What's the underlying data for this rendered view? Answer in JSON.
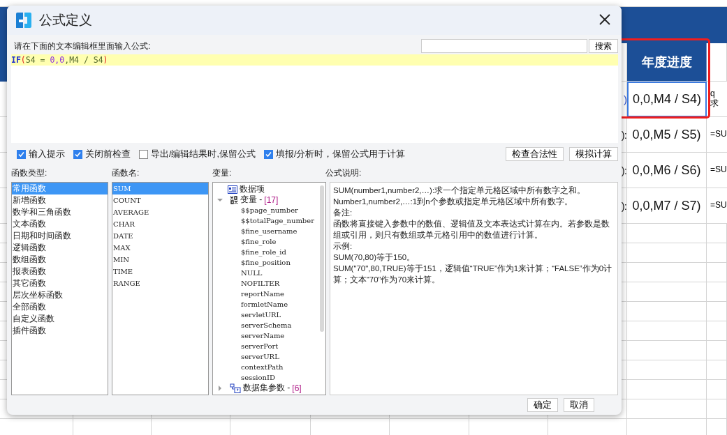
{
  "window": {
    "title": "公式定义"
  },
  "prompt": "请在下面的文本编辑框里面输入公式:",
  "search": {
    "button": "搜索"
  },
  "formula": [
    {
      "text": "IF",
      "kind": "keyword"
    },
    {
      "text": "(",
      "kind": "paren"
    },
    {
      "text": "S4 = ",
      "kind": "plain"
    },
    {
      "text": "0,0",
      "kind": "number"
    },
    {
      "text": ",M4 / S4",
      "kind": "plain"
    },
    {
      "text": ")",
      "kind": "paren"
    }
  ],
  "options": [
    {
      "label": "输入提示",
      "checked": true
    },
    {
      "label": "关闭前检查",
      "checked": true
    },
    {
      "label": "导出/编辑结果时,保留公式",
      "checked": false
    },
    {
      "label": "填报/分析时，保留公式用于计算",
      "checked": true
    }
  ],
  "actions": [
    "检查合法性",
    "模拟计算"
  ],
  "function_types": {
    "label": "函数类型:",
    "items": [
      {
        "label": "常用函数",
        "selected": true
      },
      {
        "label": "新增函数",
        "selected": false
      },
      {
        "label": "数学和三角函数",
        "selected": false
      },
      {
        "label": "文本函数",
        "selected": false
      },
      {
        "label": "日期和时间函数",
        "selected": false
      },
      {
        "label": "逻辑函数",
        "selected": false
      },
      {
        "label": "数组函数",
        "selected": false
      },
      {
        "label": "报表函数",
        "selected": false
      },
      {
        "label": "其它函数",
        "selected": false
      },
      {
        "label": "层次坐标函数",
        "selected": false
      },
      {
        "label": "全部函数",
        "selected": false
      },
      {
        "label": "自定义函数",
        "selected": false
      },
      {
        "label": "插件函数",
        "selected": false
      }
    ]
  },
  "function_names": {
    "label": "函数名:",
    "items": [
      {
        "label": "SUM",
        "selected": true
      },
      {
        "label": "COUNT",
        "selected": false
      },
      {
        "label": "AVERAGE",
        "selected": false
      },
      {
        "label": "CHAR",
        "selected": false
      },
      {
        "label": "DATE",
        "selected": false
      },
      {
        "label": "MAX",
        "selected": false
      },
      {
        "label": "MIN",
        "selected": false
      },
      {
        "label": "TIME",
        "selected": false
      },
      {
        "label": "RANGE",
        "selected": false
      }
    ]
  },
  "variables": {
    "label": "变量:",
    "tree": [
      {
        "label": "数据项",
        "kind": "item"
      },
      {
        "label": "变量 -",
        "count": "[17]",
        "kind": "group",
        "expanded": true,
        "children": [
          {
            "label": "$$page_number"
          },
          {
            "label": "$$totalPage_number"
          },
          {
            "label": "$fine_username"
          },
          {
            "label": "$fine_role"
          },
          {
            "label": "$fine_role_id"
          },
          {
            "label": "$fine_position"
          },
          {
            "label": "NULL"
          },
          {
            "label": "NOFILTER"
          },
          {
            "label": "reportName"
          },
          {
            "label": "formletName"
          },
          {
            "label": "servletURL"
          },
          {
            "label": "serverSchema"
          },
          {
            "label": "serverName"
          },
          {
            "label": "serverPort"
          },
          {
            "label": "serverURL"
          },
          {
            "label": "contextPath"
          },
          {
            "label": "sessionID"
          }
        ]
      },
      {
        "label": "数据集参数 -",
        "count": "[6]",
        "kind": "dataset",
        "expanded": false
      }
    ]
  },
  "description": {
    "label": "公式说明:",
    "paragraphs": [
      "SUM(number1,number2,…):求一个指定单元格区域中所有数字之和。",
      "Number1,number2,…:1到n个参数或指定单元格区域中所有数字。",
      "备注:",
      "函数将直接键入参数中的数值、逻辑值及文本表达式计算在内。若参数是数组或引用，则只有数组或单元格引用中的数值进行计算。",
      "示例:",
      "SUM(70,80)等于150。",
      "SUM(\"70\",80,TRUE)等于151，逻辑值“TRUE”作为1来计算；“FALSE”作为0计算；文本“70”作为70来计算。"
    ]
  },
  "footer_buttons": [
    "确定",
    "取消"
  ],
  "sheet": {
    "header": "年度进度",
    "rows": [
      {
        "column_1": ")",
        "column_2": "0,0,M4 / S4)",
        "column_3": "q\n求",
        "selected": true
      },
      {
        "column_1": "):",
        "column_2": "0,0,M5 / S5)",
        "column_3": "=SU",
        "selected": false
      },
      {
        "column_1": "):",
        "column_2": "0,0,M6 / S6)",
        "column_3": "=SU",
        "selected": false
      },
      {
        "column_1": "):",
        "column_2": "0,0,M7 / S7)",
        "column_3": "=SU",
        "selected": false
      }
    ]
  }
}
